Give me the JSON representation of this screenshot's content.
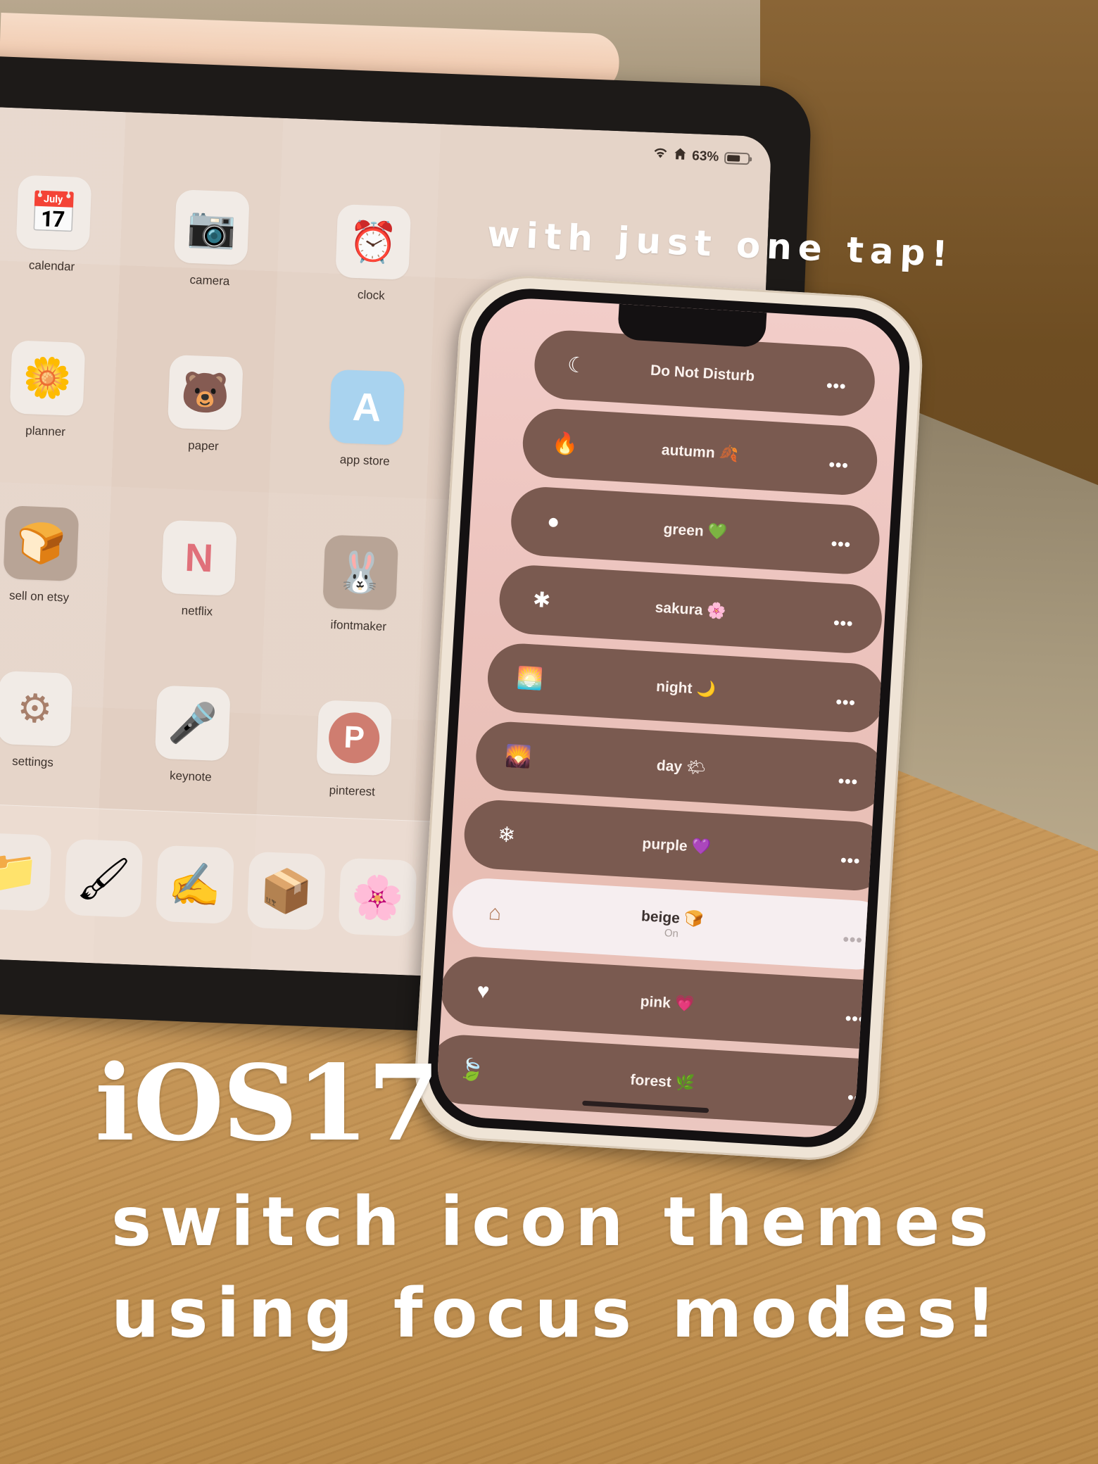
{
  "overlay": {
    "tagline": "with just one tap!",
    "headline_ios": "iOS17",
    "headline_line1": "switch icon themes",
    "headline_line2": "using focus modes!"
  },
  "ipad": {
    "status_bar": {
      "wifi_icon": "wifi-icon",
      "home_icon": "home-icon",
      "battery_percent": "63%",
      "battery_level": 0.63
    },
    "apps": [
      {
        "label": "calendar",
        "icon": "calendar-icon",
        "glyph": "📅"
      },
      {
        "label": "camera",
        "icon": "camera-icon",
        "glyph": "📷"
      },
      {
        "label": "clock",
        "icon": "alarm-clock-icon",
        "glyph": "⏰"
      },
      {
        "label": "planner",
        "icon": "flower-icon",
        "glyph": "🌼"
      },
      {
        "label": "paper",
        "icon": "bear-icon",
        "glyph": "🐻"
      },
      {
        "label": "app store",
        "icon": "app-store-icon",
        "glyph": "A"
      },
      {
        "label": "sell on etsy",
        "icon": "toast-icon",
        "glyph": "🍞"
      },
      {
        "label": "netflix",
        "icon": "netflix-icon",
        "glyph": "N"
      },
      {
        "label": "ifontmaker",
        "icon": "bunny-icon",
        "glyph": "🐰"
      },
      {
        "label": "settings",
        "icon": "gear-icon",
        "glyph": "⚙"
      },
      {
        "label": "keynote",
        "icon": "podium-icon",
        "glyph": "🎤"
      },
      {
        "label": "pinterest",
        "icon": "pinterest-icon",
        "glyph": "P"
      }
    ],
    "dock": [
      {
        "icon": "folder-icon",
        "glyph": "📁"
      },
      {
        "icon": "procreate-brush-icon",
        "glyph": "🖌"
      },
      {
        "icon": "notes-pen-icon",
        "glyph": "✍"
      },
      {
        "icon": "box-icon",
        "glyph": "📦"
      },
      {
        "icon": "photos-flower-icon",
        "glyph": "🌸"
      }
    ]
  },
  "iphone": {
    "focus_modes": [
      {
        "name": "Do Not Disturb",
        "emoji": "",
        "icon": "moon-icon",
        "glyph": "☾",
        "status": "",
        "active": false
      },
      {
        "name": "autumn",
        "emoji": "🍂",
        "icon": "flame-icon",
        "glyph": "🔥",
        "status": "",
        "active": false
      },
      {
        "name": "green",
        "emoji": "💚",
        "icon": "circle-icon",
        "glyph": "●",
        "status": "",
        "active": false
      },
      {
        "name": "sakura",
        "emoji": "🌸",
        "icon": "asterisk-icon",
        "glyph": "✱",
        "status": "",
        "active": false
      },
      {
        "name": "night",
        "emoji": "🌙",
        "icon": "sunset-icon",
        "glyph": "🌅",
        "status": "",
        "active": false
      },
      {
        "name": "day",
        "emoji": "🌤",
        "icon": "sunrise-icon",
        "glyph": "🌄",
        "status": "",
        "active": false
      },
      {
        "name": "purple",
        "emoji": "💜",
        "icon": "snowflake-icon",
        "glyph": "❄",
        "status": "",
        "active": false
      },
      {
        "name": "beige",
        "emoji": "🍞",
        "icon": "house-icon",
        "glyph": "⌂",
        "status": "On",
        "active": true
      },
      {
        "name": "pink",
        "emoji": "💗",
        "icon": "heart-icon",
        "glyph": "♥",
        "status": "",
        "active": false
      },
      {
        "name": "forest",
        "emoji": "🌿",
        "icon": "leaf-icon",
        "glyph": "🍃",
        "status": "",
        "active": false
      }
    ],
    "more_label": "•••"
  }
}
